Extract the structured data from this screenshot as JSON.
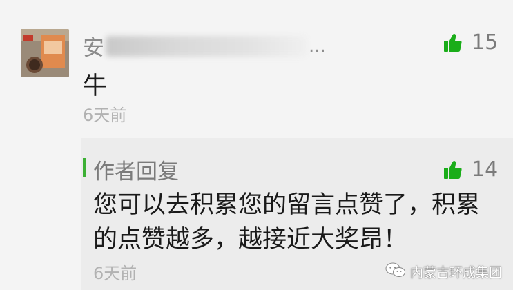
{
  "comment": {
    "username_visible": "安",
    "ellipsis": "...",
    "text": "牛",
    "time": "6天前",
    "likes": "15"
  },
  "reply": {
    "title": "作者回复",
    "text": "您可以去积累您的留言点赞了，积累的点赞越多，越接近大奖昂！",
    "time": "6天前",
    "likes": "14"
  },
  "watermark": {
    "text": "内蒙古环成集团"
  },
  "colors": {
    "like_icon": "#1aad19",
    "reply_bar": "#3cb034",
    "reply_bg": "#ececec",
    "page_bg": "#f4f4f4"
  }
}
